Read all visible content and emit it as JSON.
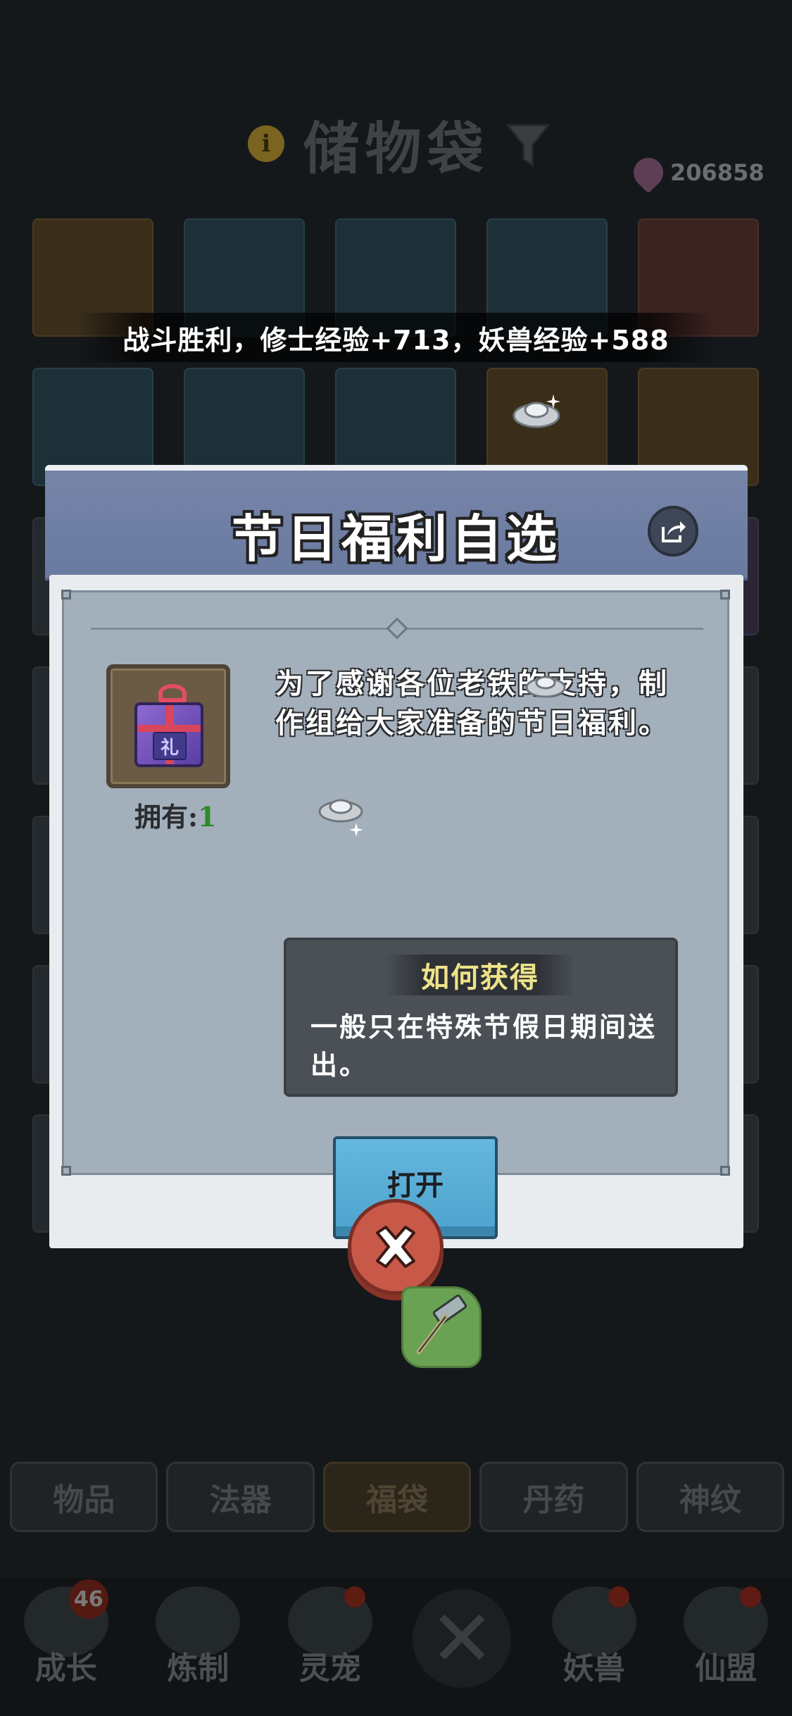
{
  "background": {
    "title": "储物袋",
    "currency_amount": "206858",
    "toast": "战斗胜利，修士经验+713，妖兽经验+588",
    "tabs": [
      "物品",
      "法器",
      "福袋",
      "丹药",
      "神纹"
    ],
    "active_tab": "福袋",
    "nav": [
      {
        "label": "成长",
        "badge": "46"
      },
      {
        "label": "炼制",
        "badge": ""
      },
      {
        "label": "灵宠",
        "badge": "dot"
      },
      {
        "label": "",
        "badge": ""
      },
      {
        "label": "妖兽",
        "badge": "dot"
      },
      {
        "label": "仙盟",
        "badge": "dot"
      }
    ]
  },
  "modal": {
    "title": "节日福利自选",
    "item_char": "礼",
    "own_label": "拥有:",
    "own_value": "1",
    "description": "为了感谢各位老铁的支持，制作组给大家准备的节日福利。",
    "how_title": "如何获得",
    "how_text": "一般只在特殊节假日期间送出。",
    "open_label": "打开"
  },
  "icons": {
    "share": "share-icon",
    "close": "close-icon",
    "gift": "gift-box-icon",
    "info": "info-icon",
    "filter": "filter-icon",
    "gem": "gem-icon",
    "silver": "silver-ingot-icon",
    "hammer_scroll": "hammer-scroll-icon"
  },
  "colors": {
    "modal_header": "#7685a8",
    "panel": "#a3afbb",
    "open_button": "#5aaed6",
    "close_button": "#c85848",
    "how_title": "#efe38a",
    "own_value": "#2f8a25"
  }
}
